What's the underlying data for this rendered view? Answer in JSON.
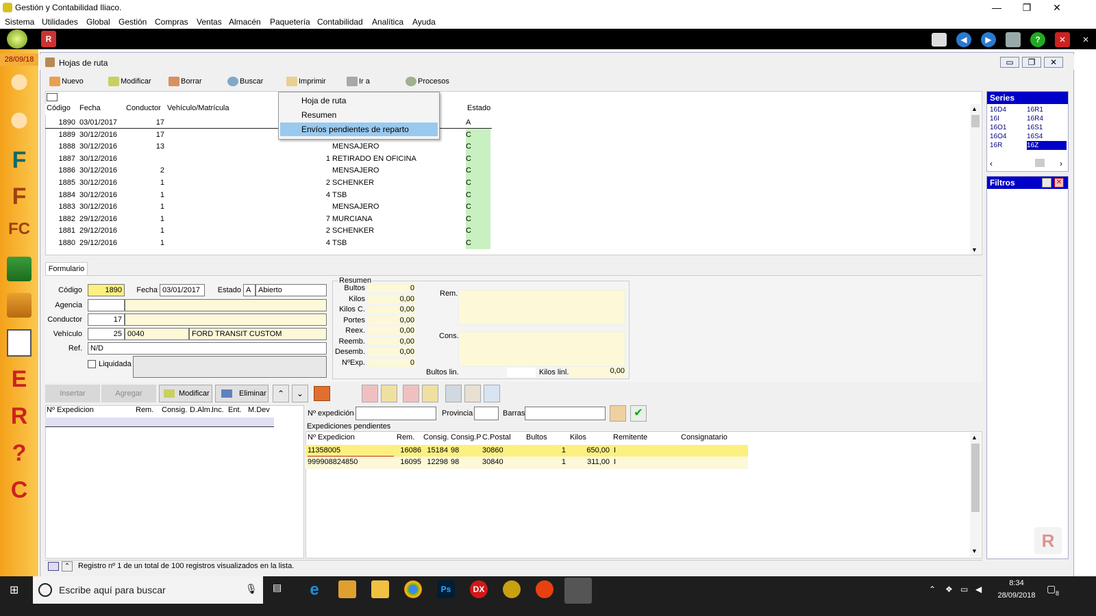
{
  "app": {
    "title": "Gestión y Contabilidad Iliaco.",
    "date_badge": "28/09/18"
  },
  "menu": [
    "Sistema",
    "Utilidades",
    "Global",
    "Gestión",
    "Compras",
    "Ventas",
    "Almacén",
    "Paquetería",
    "Contabilidad",
    "Analítica",
    "Ayuda"
  ],
  "inner": {
    "title": "Hojas de ruta"
  },
  "toolbar": {
    "nuevo": "Nuevo",
    "modificar": "Modificar",
    "borrar": "Borrar",
    "buscar": "Buscar",
    "imprimir": "Imprimir",
    "ira": "Ir a",
    "procesos": "Procesos"
  },
  "dropdown": {
    "items": [
      "Hoja de ruta",
      "Resumen",
      "Envíos pendientes de reparto"
    ]
  },
  "grid": {
    "headers": {
      "codigo": "Código",
      "fecha": "Fecha",
      "conductor": "Conductor",
      "vehiculo": "Vehículo/Matrícula",
      "estado": "Estado"
    },
    "rows": [
      {
        "codigo": "1890",
        "fecha": "03/01/2017",
        "conductor": "17",
        "num": "",
        "agencia": "",
        "estado": "A"
      },
      {
        "codigo": "1889",
        "fecha": "30/12/2016",
        "conductor": "17",
        "num": "",
        "agencia": "",
        "estado": "C"
      },
      {
        "codigo": "1888",
        "fecha": "30/12/2016",
        "conductor": "13",
        "num": "",
        "agencia": "MENSAJERO",
        "estado": "C"
      },
      {
        "codigo": "1887",
        "fecha": "30/12/2016",
        "conductor": "",
        "num": "1",
        "agencia": "RETIRADO EN OFICINA",
        "estado": "C"
      },
      {
        "codigo": "1886",
        "fecha": "30/12/2016",
        "conductor": "2",
        "num": "",
        "agencia": "MENSAJERO",
        "estado": "C"
      },
      {
        "codigo": "1885",
        "fecha": "30/12/2016",
        "conductor": "1",
        "num": "2",
        "agencia": "SCHENKER",
        "estado": "C"
      },
      {
        "codigo": "1884",
        "fecha": "30/12/2016",
        "conductor": "1",
        "num": "4",
        "agencia": "TSB",
        "estado": "C"
      },
      {
        "codigo": "1883",
        "fecha": "30/12/2016",
        "conductor": "1",
        "num": "",
        "agencia": "MENSAJERO",
        "estado": "C"
      },
      {
        "codigo": "1882",
        "fecha": "29/12/2016",
        "conductor": "1",
        "num": "7",
        "agencia": "MURCIANA",
        "estado": "C"
      },
      {
        "codigo": "1881",
        "fecha": "29/12/2016",
        "conductor": "1",
        "num": "2",
        "agencia": "SCHENKER",
        "estado": "C"
      },
      {
        "codigo": "1880",
        "fecha": "29/12/2016",
        "conductor": "1",
        "num": "4",
        "agencia": "TSB",
        "estado": "C"
      }
    ]
  },
  "series": {
    "title": "Series",
    "col1": [
      "16D4",
      "16I",
      "16O1",
      "16O4",
      "16R"
    ],
    "col2": [
      "16R1",
      "16R4",
      "16S1",
      "16S4",
      "16Z"
    ]
  },
  "filtros": {
    "title": "Filtros"
  },
  "form": {
    "tab": "Formulario",
    "codigo_label": "Código",
    "codigo": "1890",
    "fecha_label": "Fecha",
    "fecha": "03/01/2017",
    "estado_label": "Estado",
    "estado_code": "A",
    "estado_text": "Abierto",
    "agencia_label": "Agencia",
    "conductor_label": "Conductor",
    "conductor": "17",
    "vehiculo_label": "Vehículo",
    "vehiculo_num": "25",
    "vehiculo_mat": "0040",
    "vehiculo_desc": "FORD TRANSIT CUSTOM",
    "ref_label": "Ref.",
    "ref": "N/D",
    "liquidada": "Liquidada"
  },
  "resumen": {
    "title": "Resumen",
    "labels": [
      "Bultos",
      "Kilos",
      "Kilos C.",
      "Portes",
      "Reex.",
      "Reemb.",
      "Desemb.",
      "NºExp."
    ],
    "values": [
      "0",
      "0,00",
      "0,00",
      "0,00",
      "0,00",
      "0,00",
      "0,00",
      "0"
    ],
    "rem": "Rem.",
    "cons": "Cons.",
    "bultos_lin": "Bultos lin.",
    "kilos_lin": "Kilos linl.",
    "kilos_lin_val": "0,00"
  },
  "actions": {
    "insertar": "Insertar",
    "agregar": "Agregar",
    "modificar": "Modificar",
    "eliminar": "Eliminar"
  },
  "exp_table": {
    "headers": [
      "Nº Expedicion",
      "Rem.",
      "Consig.",
      "D.Alm.",
      "Inc.",
      "Ent.",
      "M.Dev"
    ]
  },
  "search": {
    "nexp": "Nº expedición",
    "provincia": "Provincia",
    "barras": "Barras",
    "pendientes": "Expediciones pendientes"
  },
  "pend": {
    "headers": [
      "Nº Expedicion",
      "Rem.",
      "Consig.",
      "Consig.P",
      "C.Postal",
      "Bultos",
      "Kilos",
      "Remitente",
      "Consignatario"
    ],
    "rows": [
      {
        "nexp": "11358005",
        "rem": "16086",
        "consig": "15184",
        "consigp": "98",
        "cp": "30860",
        "bultos": "1",
        "kilos": "650,00",
        "remitente": "I"
      },
      {
        "nexp": "999908824850",
        "rem": "16095",
        "consig": "12298",
        "consigp": "98",
        "cp": "30840",
        "bultos": "1",
        "kilos": "311,00",
        "remitente": "I"
      }
    ]
  },
  "status": {
    "text": "Registro nº 1 de un total de 100 registros visualizados en la lista."
  },
  "taskbar": {
    "search": "Escribe aquí para buscar",
    "time": "8:34",
    "date": "28/09/2018",
    "notif": "8"
  }
}
